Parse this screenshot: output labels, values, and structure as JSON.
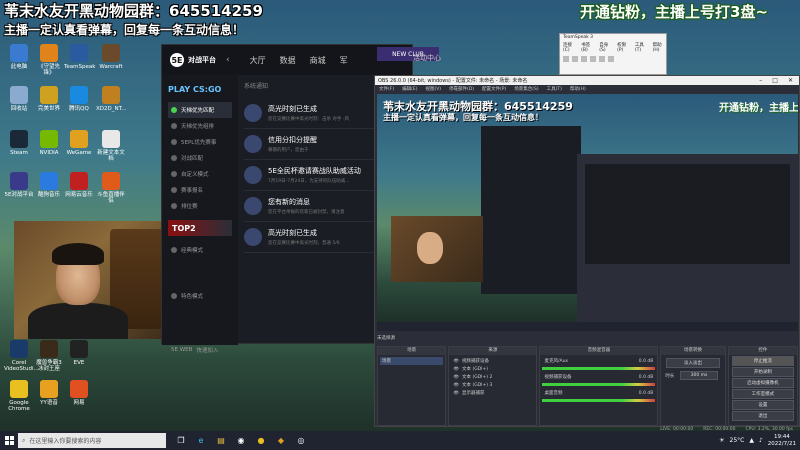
{
  "overlay": {
    "title": "苇末水友开黑动物园群：645514259",
    "subtitle": "主播一定认真看弹幕，回复每一条互动信息！",
    "right": "开通钻粉，主播上号打3盘~"
  },
  "desktop_icons": [
    {
      "label": "此电脑",
      "icon": "computer-icon",
      "color": "#3a7ad0"
    },
    {
      "label": "《守望先锋》",
      "icon": "overwatch-icon",
      "color": "#e0831a"
    },
    {
      "label": "TeamSpeak",
      "icon": "teamspeak-icon",
      "color": "#2a5aa0"
    },
    {
      "label": "Warcraft",
      "icon": "warcraft-icon",
      "color": "#6a4a2a"
    },
    {
      "label": "回收站",
      "icon": "recycle-bin-icon",
      "color": "#8aaacf"
    },
    {
      "label": "完美世界",
      "icon": "perfect-world-icon",
      "color": "#d0a020"
    },
    {
      "label": "腾讯QQ",
      "icon": "qq-icon",
      "color": "#1a8ae0"
    },
    {
      "label": "XD2D_NT...",
      "icon": "folder-icon",
      "color": "#c08020"
    },
    {
      "label": "Steam",
      "icon": "steam-icon",
      "color": "#1b2838"
    },
    {
      "label": "NVIDIA",
      "icon": "nvidia-icon",
      "color": "#76b900"
    },
    {
      "label": "WeGame",
      "icon": "wegame-icon",
      "color": "#e0a020"
    },
    {
      "label": "新建文本文档",
      "icon": "text-document-icon",
      "color": "#e8e8e8"
    },
    {
      "label": "5E对战平台",
      "icon": "5e-platform-icon",
      "color": "#3a3a8a"
    },
    {
      "label": "酷狗音乐",
      "icon": "kugou-icon",
      "color": "#2a7ae0"
    },
    {
      "label": "网易云音乐",
      "icon": "netease-music-icon",
      "color": "#c02020"
    },
    {
      "label": "斗鱼直播伴侣",
      "icon": "douyu-icon",
      "color": "#e05a1a"
    },
    {
      "label": "Corel VideoStudi...",
      "icon": "corel-icon",
      "color": "#1a3a6a"
    },
    {
      "label": "魔兽争霸3冰封王座",
      "icon": "war3-icon",
      "color": "#3a2a1a"
    },
    {
      "label": "EVE",
      "icon": "eve-icon",
      "color": "#222222"
    },
    {
      "label": "Google Chrome",
      "icon": "chrome-icon",
      "color": "#e8c020"
    },
    {
      "label": "YY语音",
      "icon": "yy-icon",
      "color": "#e8a020"
    },
    {
      "label": "网易",
      "icon": "netease-icon",
      "color": "#e05020"
    }
  ],
  "game_platform": {
    "logo": "对战平台",
    "nav": [
      "大厅",
      "数据",
      "商城",
      "军"
    ],
    "playcsgo": "PLAY CS:GO",
    "side_items": [
      {
        "label": "天梯优先匹配",
        "active": true
      },
      {
        "label": "天梯优先组排",
        "active": false
      },
      {
        "label": "5EPL优先赛事",
        "active": false
      },
      {
        "label": "对战匹配",
        "active": false
      },
      {
        "label": "自定义模式",
        "active": false
      },
      {
        "label": "赛事报名",
        "active": false
      },
      {
        "label": "排位赛",
        "active": false
      }
    ],
    "top2": "TOP2",
    "side_items_2": [
      {
        "label": "经典模式"
      },
      {
        "label": "特色模式"
      }
    ],
    "bottom_links": [
      "5E WEB",
      "快速加入"
    ],
    "section_title": "系统通知",
    "notices": [
      {
        "title": "高光时刻已生成",
        "desc": "您在竞赛比赛中高光时刻：击杀 对手 -风"
      },
      {
        "title": "信用分扣分提醒",
        "desc": "尊敬的用户，您由于"
      },
      {
        "title": "5E全民杯邀请赛战队助威活动",
        "desc": "7月19日-7月24日，为支持的队伍助威..."
      },
      {
        "title": "您有新的消息",
        "desc": "您在平台举报的玩家已被封禁，请注意"
      },
      {
        "title": "高光时刻已生成",
        "desc": "您在竞赛比赛中高光时刻，普通 5/6"
      }
    ],
    "activity_tab": "活动中心",
    "banner": "NEW CLUB"
  },
  "obs": {
    "title": "OBS 26.0.0 (64-bit, windows) - 配置文件: 未命名 - 场景: 未命名",
    "menus": [
      "文件(F)",
      "编辑(E)",
      "视图(V)",
      "停靠部件(D)",
      "配置文件(P)",
      "场景集合(S)",
      "工具(T)",
      "帮助(H)"
    ],
    "preview": {
      "text1": "苇末水友开黑动物园群：645514259",
      "text2": "主播一定认真看弹幕，回复每一条互动信息！",
      "text3": "开通钻粉，主播上号打3盘~"
    },
    "scene_label": "未选择源",
    "docks": {
      "scenes": {
        "header": "场景",
        "items": [
          "场景"
        ]
      },
      "sources": {
        "header": "来源",
        "items": [
          "视频捕获设备",
          "文本 (GDI+)",
          "文本 (GDI+) 2",
          "文本 (GDI+) 3",
          "显示器捕获"
        ]
      },
      "mixer": {
        "header": "音频混音器",
        "channels": [
          {
            "label": "麦克风/Aux",
            "db": "0.0 dB"
          },
          {
            "label": "视频捕获设备",
            "db": "0.0 dB"
          },
          {
            "label": "桌面音频",
            "db": "0.0 dB"
          }
        ]
      },
      "transitions": {
        "header": "场景转换",
        "mode": "淡入淡出",
        "duration_label": "时长",
        "duration": "300 ms"
      },
      "controls": {
        "header": "控件",
        "buttons": [
          "停止推流",
          "开始录制",
          "启动虚拟摄像机",
          "工作室模式",
          "设置",
          "退出"
        ]
      }
    },
    "status": {
      "live": "LIVE: 00:00:00",
      "rec": "REC: 00:00:00",
      "cpu": "CPU: 3.2%, 30.00 fps"
    }
  },
  "teamspeak": {
    "title": "TeamSpeak 3",
    "menus": [
      "连接(C)",
      "书签(B)",
      "自身(S)",
      "权限(P)",
      "工具(T)",
      "帮助(H)"
    ]
  },
  "taskbar": {
    "search_placeholder": "在这里输入你要搜索的内容",
    "weather": "25°C",
    "time": "19:44",
    "date": "2022/7/21"
  }
}
